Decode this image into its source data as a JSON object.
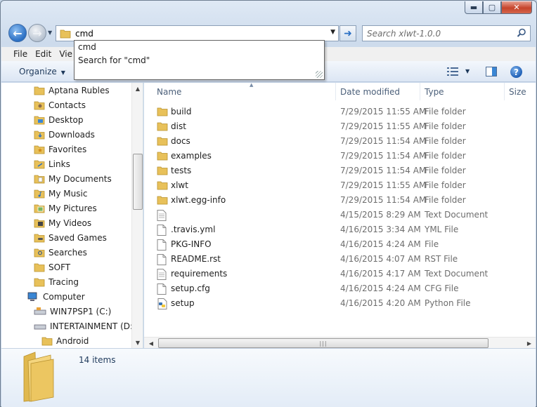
{
  "window": {
    "caption_minimize": "▬",
    "caption_maximize": "▢",
    "caption_close": "✕"
  },
  "address": {
    "value": "cmd",
    "search_placeholder": "Search xlwt-1.0.0"
  },
  "autocomplete": {
    "items": [
      "cmd",
      "Search for \"cmd\""
    ]
  },
  "menubar": {
    "file": "File",
    "edit": "Edit",
    "view": "Vie"
  },
  "toolbar": {
    "organize": "Organize"
  },
  "nav_tree": [
    {
      "label": "Aptana Rubles",
      "icon": "folder-icon"
    },
    {
      "label": "Contacts",
      "icon": "contacts-icon"
    },
    {
      "label": "Desktop",
      "icon": "desktop-icon"
    },
    {
      "label": "Downloads",
      "icon": "downloads-icon"
    },
    {
      "label": "Favorites",
      "icon": "favorites-icon"
    },
    {
      "label": "Links",
      "icon": "links-icon"
    },
    {
      "label": "My Documents",
      "icon": "documents-icon"
    },
    {
      "label": "My Music",
      "icon": "music-icon"
    },
    {
      "label": "My Pictures",
      "icon": "pictures-icon"
    },
    {
      "label": "My Videos",
      "icon": "videos-icon"
    },
    {
      "label": "Saved Games",
      "icon": "saved-games-icon"
    },
    {
      "label": "Searches",
      "icon": "searches-icon"
    },
    {
      "label": "SOFT",
      "icon": "folder-icon"
    },
    {
      "label": "Tracing",
      "icon": "folder-icon"
    },
    {
      "label": "Computer",
      "icon": "computer-icon"
    },
    {
      "label": "WIN7PSP1 (C:)",
      "icon": "drive-icon"
    },
    {
      "label": "INTERTAINMENT (D:)",
      "icon": "drive-icon"
    },
    {
      "label": "Android",
      "icon": "folder-icon"
    }
  ],
  "columns": {
    "name": "Name",
    "date": "Date modified",
    "type": "Type",
    "size": "Size"
  },
  "files": [
    {
      "name": "build",
      "date": "7/29/2015 11:55 AM",
      "type": "File folder",
      "icon": "folder-icon"
    },
    {
      "name": "dist",
      "date": "7/29/2015 11:55 AM",
      "type": "File folder",
      "icon": "folder-icon"
    },
    {
      "name": "docs",
      "date": "7/29/2015 11:54 AM",
      "type": "File folder",
      "icon": "folder-icon"
    },
    {
      "name": "examples",
      "date": "7/29/2015 11:54 AM",
      "type": "File folder",
      "icon": "folder-icon"
    },
    {
      "name": "tests",
      "date": "7/29/2015 11:54 AM",
      "type": "File folder",
      "icon": "folder-icon"
    },
    {
      "name": "xlwt",
      "date": "7/29/2015 11:55 AM",
      "type": "File folder",
      "icon": "folder-icon"
    },
    {
      "name": "xlwt.egg-info",
      "date": "7/29/2015 11:54 AM",
      "type": "File folder",
      "icon": "folder-icon"
    },
    {
      "name": "",
      "date": "4/15/2015 8:29 AM",
      "type": "Text Document",
      "icon": "text-file-icon"
    },
    {
      "name": ".travis.yml",
      "date": "4/16/2015 3:34 AM",
      "type": "YML File",
      "icon": "file-icon"
    },
    {
      "name": "PKG-INFO",
      "date": "4/16/2015 4:24 AM",
      "type": "File",
      "icon": "file-icon"
    },
    {
      "name": "README.rst",
      "date": "4/16/2015 4:07 AM",
      "type": "RST File",
      "icon": "file-icon"
    },
    {
      "name": "requirements",
      "date": "4/16/2015 4:17 AM",
      "type": "Text Document",
      "icon": "text-file-icon"
    },
    {
      "name": "setup.cfg",
      "date": "4/16/2015 4:24 AM",
      "type": "CFG File",
      "icon": "file-icon"
    },
    {
      "name": "setup",
      "date": "4/16/2015 4:20 AM",
      "type": "Python File",
      "icon": "python-file-icon"
    }
  ],
  "details": {
    "count": "14 items"
  },
  "colors": {
    "folder": "#e8c15a",
    "accent": "#2a6fc4",
    "secondary_text": "#6d6d6d"
  }
}
